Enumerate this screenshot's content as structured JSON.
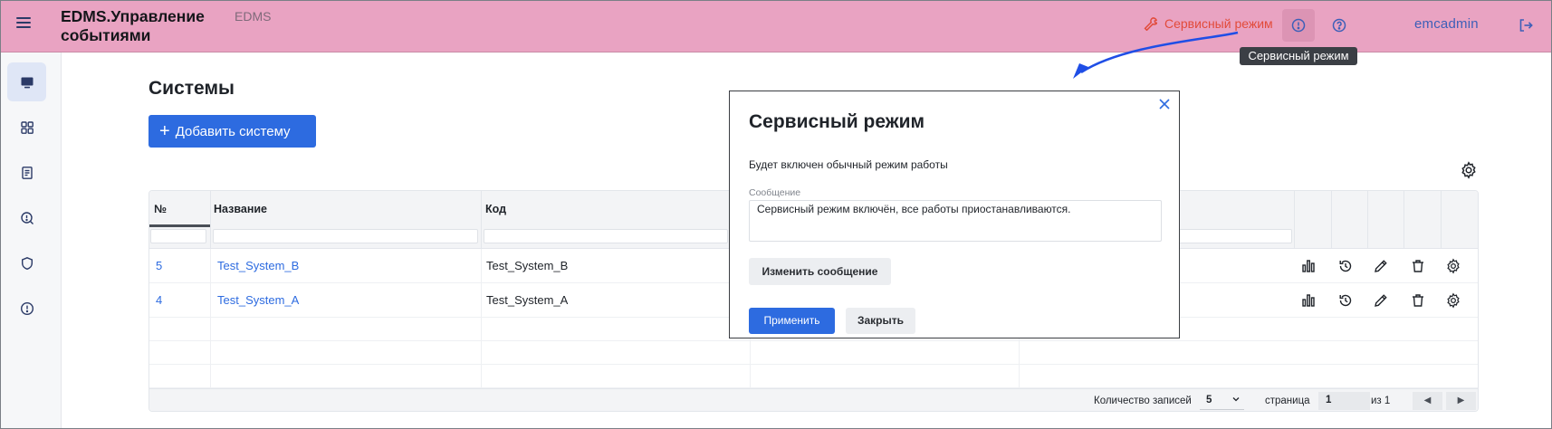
{
  "header": {
    "app_title": "EDMS.Управление событиями",
    "app_subtitle": "EDMS",
    "service_mode_link": "Сервисный режим",
    "user_name": "emcadmin",
    "tooltip": "Сервисный режим",
    "accent_color": "#e24b3a"
  },
  "sidebar": {
    "items": [
      {
        "icon": "monitor-icon",
        "active": true
      },
      {
        "icon": "grid-icon",
        "active": false
      },
      {
        "icon": "document-icon",
        "active": false
      },
      {
        "icon": "alert-search-icon",
        "active": false
      },
      {
        "icon": "shield-icon",
        "active": false
      },
      {
        "icon": "info-circle-icon",
        "active": false
      }
    ]
  },
  "main": {
    "page_title": "Системы",
    "add_button": "Добавить систему",
    "table": {
      "columns": [
        "№",
        "Название",
        "Код"
      ],
      "rows": [
        {
          "num": "5",
          "name": "Test_System_B",
          "code": "Test_System_B"
        },
        {
          "num": "4",
          "name": "Test_System_A",
          "code": "Test_System_A"
        }
      ],
      "row_actions": [
        "bar-chart-icon",
        "history-icon",
        "pencil-icon",
        "trash-icon",
        "gear-icon"
      ]
    },
    "footer": {
      "records_label": "Количество записей",
      "records_value": "5",
      "page_label": "страница",
      "page_value": "1",
      "total_label": "из 1",
      "prev": "◀",
      "next": "▶"
    }
  },
  "modal": {
    "title": "Сервисный режим",
    "text": "Будет включен обычный режим работы",
    "message_label": "Сообщение",
    "message_value": "Сервисный режим включён, все работы приостанавливаются.",
    "change_button": "Изменить сообщение",
    "apply_button": "Применить",
    "close_button": "Закрыть"
  }
}
